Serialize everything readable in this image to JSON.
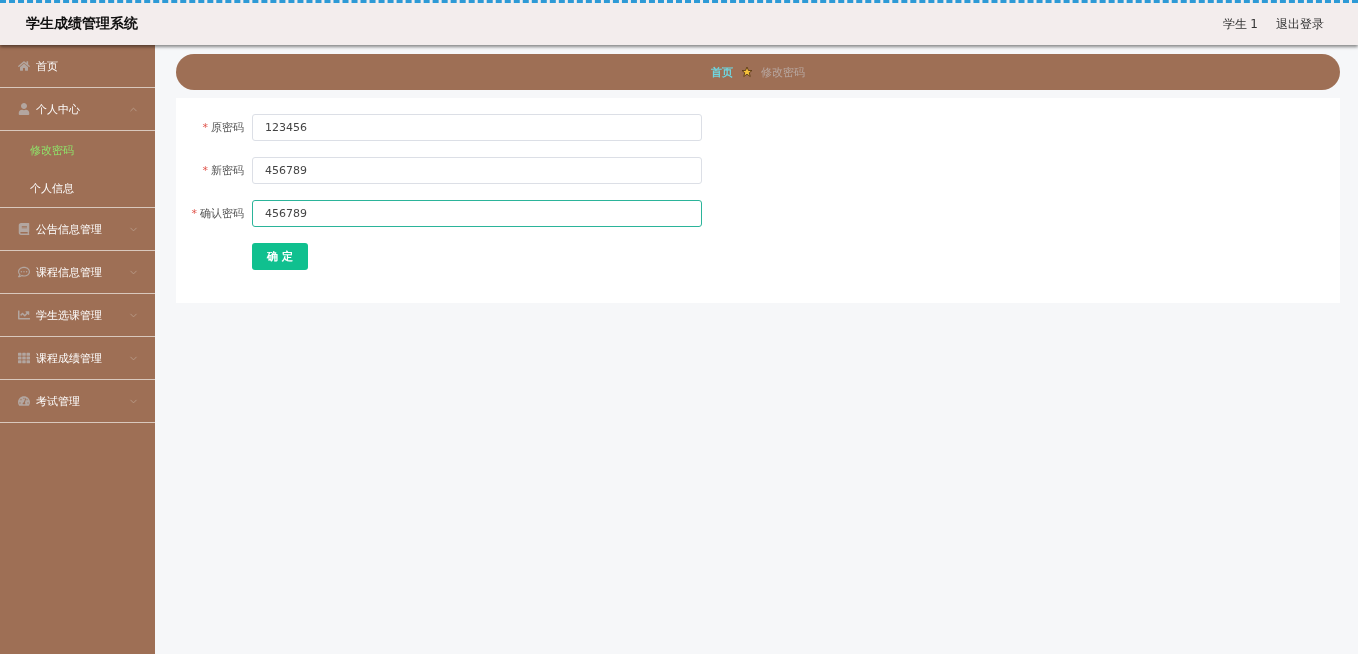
{
  "header": {
    "title": "学生成绩管理系统",
    "user": "学生 1",
    "logout": "退出登录"
  },
  "sidebar": {
    "items": [
      {
        "label": "首页"
      },
      {
        "label": "个人中心",
        "expanded": true,
        "children": [
          {
            "label": "修改密码",
            "selected": true
          },
          {
            "label": "个人信息",
            "selected": false
          }
        ]
      },
      {
        "label": "公告信息管理",
        "expanded": false
      },
      {
        "label": "课程信息管理",
        "expanded": false
      },
      {
        "label": "学生选课管理",
        "expanded": false
      },
      {
        "label": "课程成绩管理",
        "expanded": false
      },
      {
        "label": "考试管理",
        "expanded": false
      }
    ]
  },
  "breadcrumb": [
    {
      "label": "首页",
      "selected": false
    },
    {
      "label": "修改密码",
      "selected": true
    }
  ],
  "form": {
    "fields": [
      {
        "label": "原密码",
        "mark": "*",
        "value": "123456",
        "focused": false
      },
      {
        "label": "新密码",
        "mark": "*",
        "value": "456789",
        "focused": false
      },
      {
        "label": "确认密码",
        "mark": "*",
        "value": "456789",
        "focused": true
      }
    ],
    "submit": "确 定"
  }
}
